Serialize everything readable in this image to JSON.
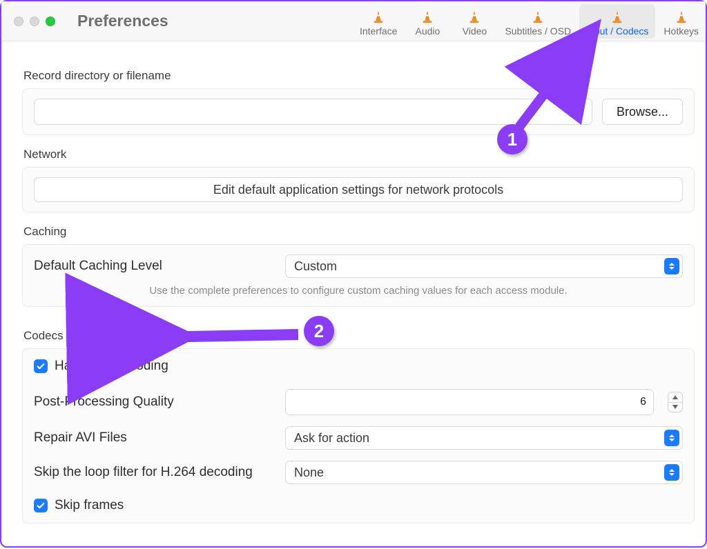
{
  "window": {
    "title": "Preferences"
  },
  "tabs": {
    "interface": "Interface",
    "audio": "Audio",
    "video": "Video",
    "subtitles": "Subtitles / OSD",
    "input_codecs": "Input / Codecs",
    "hotkeys": "Hotkeys"
  },
  "record": {
    "header": "Record directory or filename",
    "value": "",
    "browse": "Browse..."
  },
  "network": {
    "header": "Network",
    "button": "Edit default application settings for network protocols"
  },
  "caching": {
    "header": "Caching",
    "label": "Default Caching Level",
    "value": "Custom",
    "hint": "Use the complete preferences to configure custom caching values for each access module."
  },
  "codecs": {
    "header": "Codecs / Muxers",
    "hw_decoding": "Hardware decoding",
    "post_quality_label": "Post-Processing Quality",
    "post_quality_value": "6",
    "repair_label": "Repair AVI Files",
    "repair_value": "Ask for action",
    "loop_label": "Skip the loop filter for H.264 decoding",
    "loop_value": "None",
    "skip_frames": "Skip frames"
  },
  "annotations": {
    "badge1": "1",
    "badge2": "2"
  }
}
